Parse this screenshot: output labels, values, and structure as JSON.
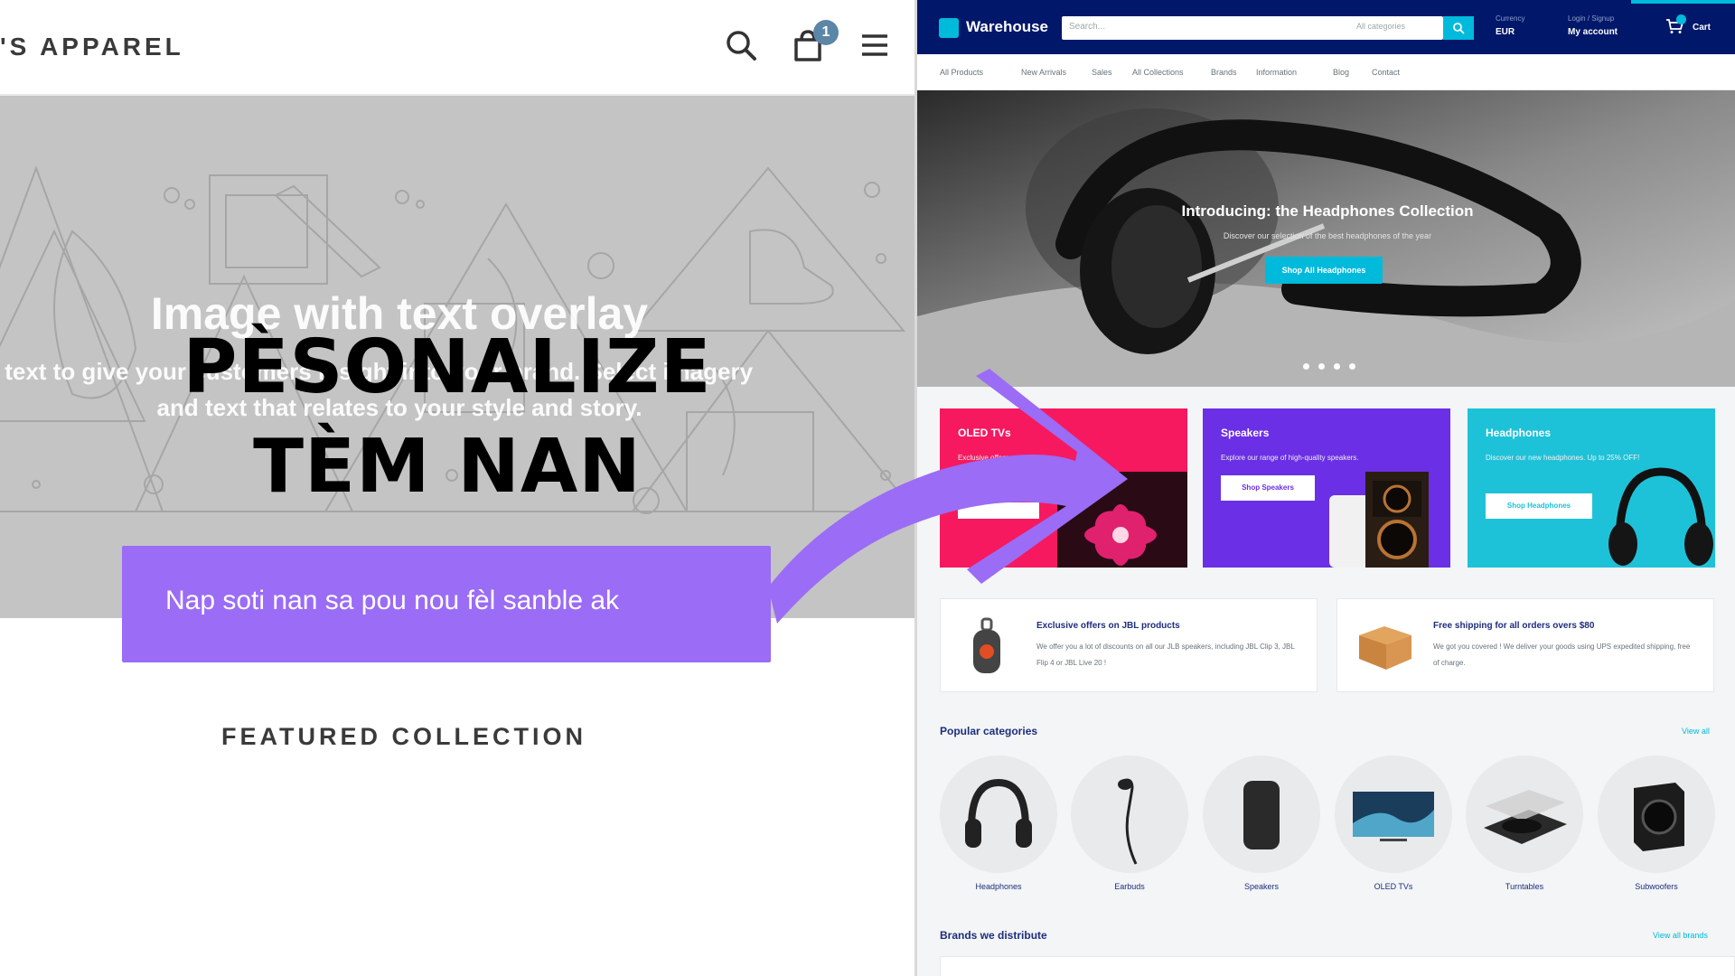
{
  "left_store": {
    "brand": "'S APPAREL",
    "cart_count": "1",
    "hero": {
      "title": "Image with text overlay",
      "body_line1": "overlay text to give your customers insight into your brand. Select imagery",
      "body_line2": "and text that relates to your style and story."
    },
    "featured_heading": "FEATURED COLLECTION"
  },
  "overlay": {
    "title_line1": "PÈSONALIZE",
    "title_line2": "TÈM NAN",
    "callout_text": "Nap soti nan sa pou nou fèl sanble ak",
    "callout_color": "#9b6cf5",
    "arrow_color": "#9b6cf5"
  },
  "warehouse": {
    "logo_text": "Warehouse",
    "search": {
      "placeholder": "Search...",
      "category": "All categories"
    },
    "currency": {
      "label": "Currency",
      "value": "EUR"
    },
    "account": {
      "label": "Login / Signup",
      "value": "My account"
    },
    "cart_label": "Cart",
    "nav": [
      "All Products",
      "New Arrivals",
      "Sales",
      "All Collections",
      "Brands",
      "Information",
      "Blog",
      "Contact"
    ],
    "slideshow": {
      "title": "Introducing: the Headphones Collection",
      "subtitle": "Discover our selection of the best headphones of the year",
      "button": "Shop All Headphones",
      "dots": 4
    },
    "promos": [
      {
        "title": "OLED TVs",
        "text": "Exclusive offers",
        "button": ""
      },
      {
        "title": "Speakers",
        "text": "Explore our range of high-quality speakers.",
        "button": "Shop Speakers"
      },
      {
        "title": "Headphones",
        "text": "Discover our new headphones. Up to 25% OFF!",
        "button": "Shop Headphones"
      }
    ],
    "info_blocks": [
      {
        "title": "Exclusive offers on JBL products",
        "text": "We offer you a lot of discounts on all our JLB speakers, including JBL Clip 3, JBL Flip 4 or JBL Live 20 !"
      },
      {
        "title": "Free shipping for all orders overs $80",
        "text": "We got you covered ! We deliver your goods using UPS expedited shipping, free of charge."
      }
    ],
    "popular_categories": {
      "title": "Popular categories",
      "view_all": "View all",
      "items": [
        "Headphones",
        "Earbuds",
        "Speakers",
        "OLED TVs",
        "Turntables",
        "Subwoofers"
      ]
    },
    "brands": {
      "title": "Brands we distribute",
      "view_all": "View all brands"
    },
    "colors": {
      "topbar": "#00176a",
      "accent": "#00badb",
      "oled": "#f6195f",
      "speakers": "#6b2fe5",
      "headphones": "#1ec2d8"
    }
  }
}
